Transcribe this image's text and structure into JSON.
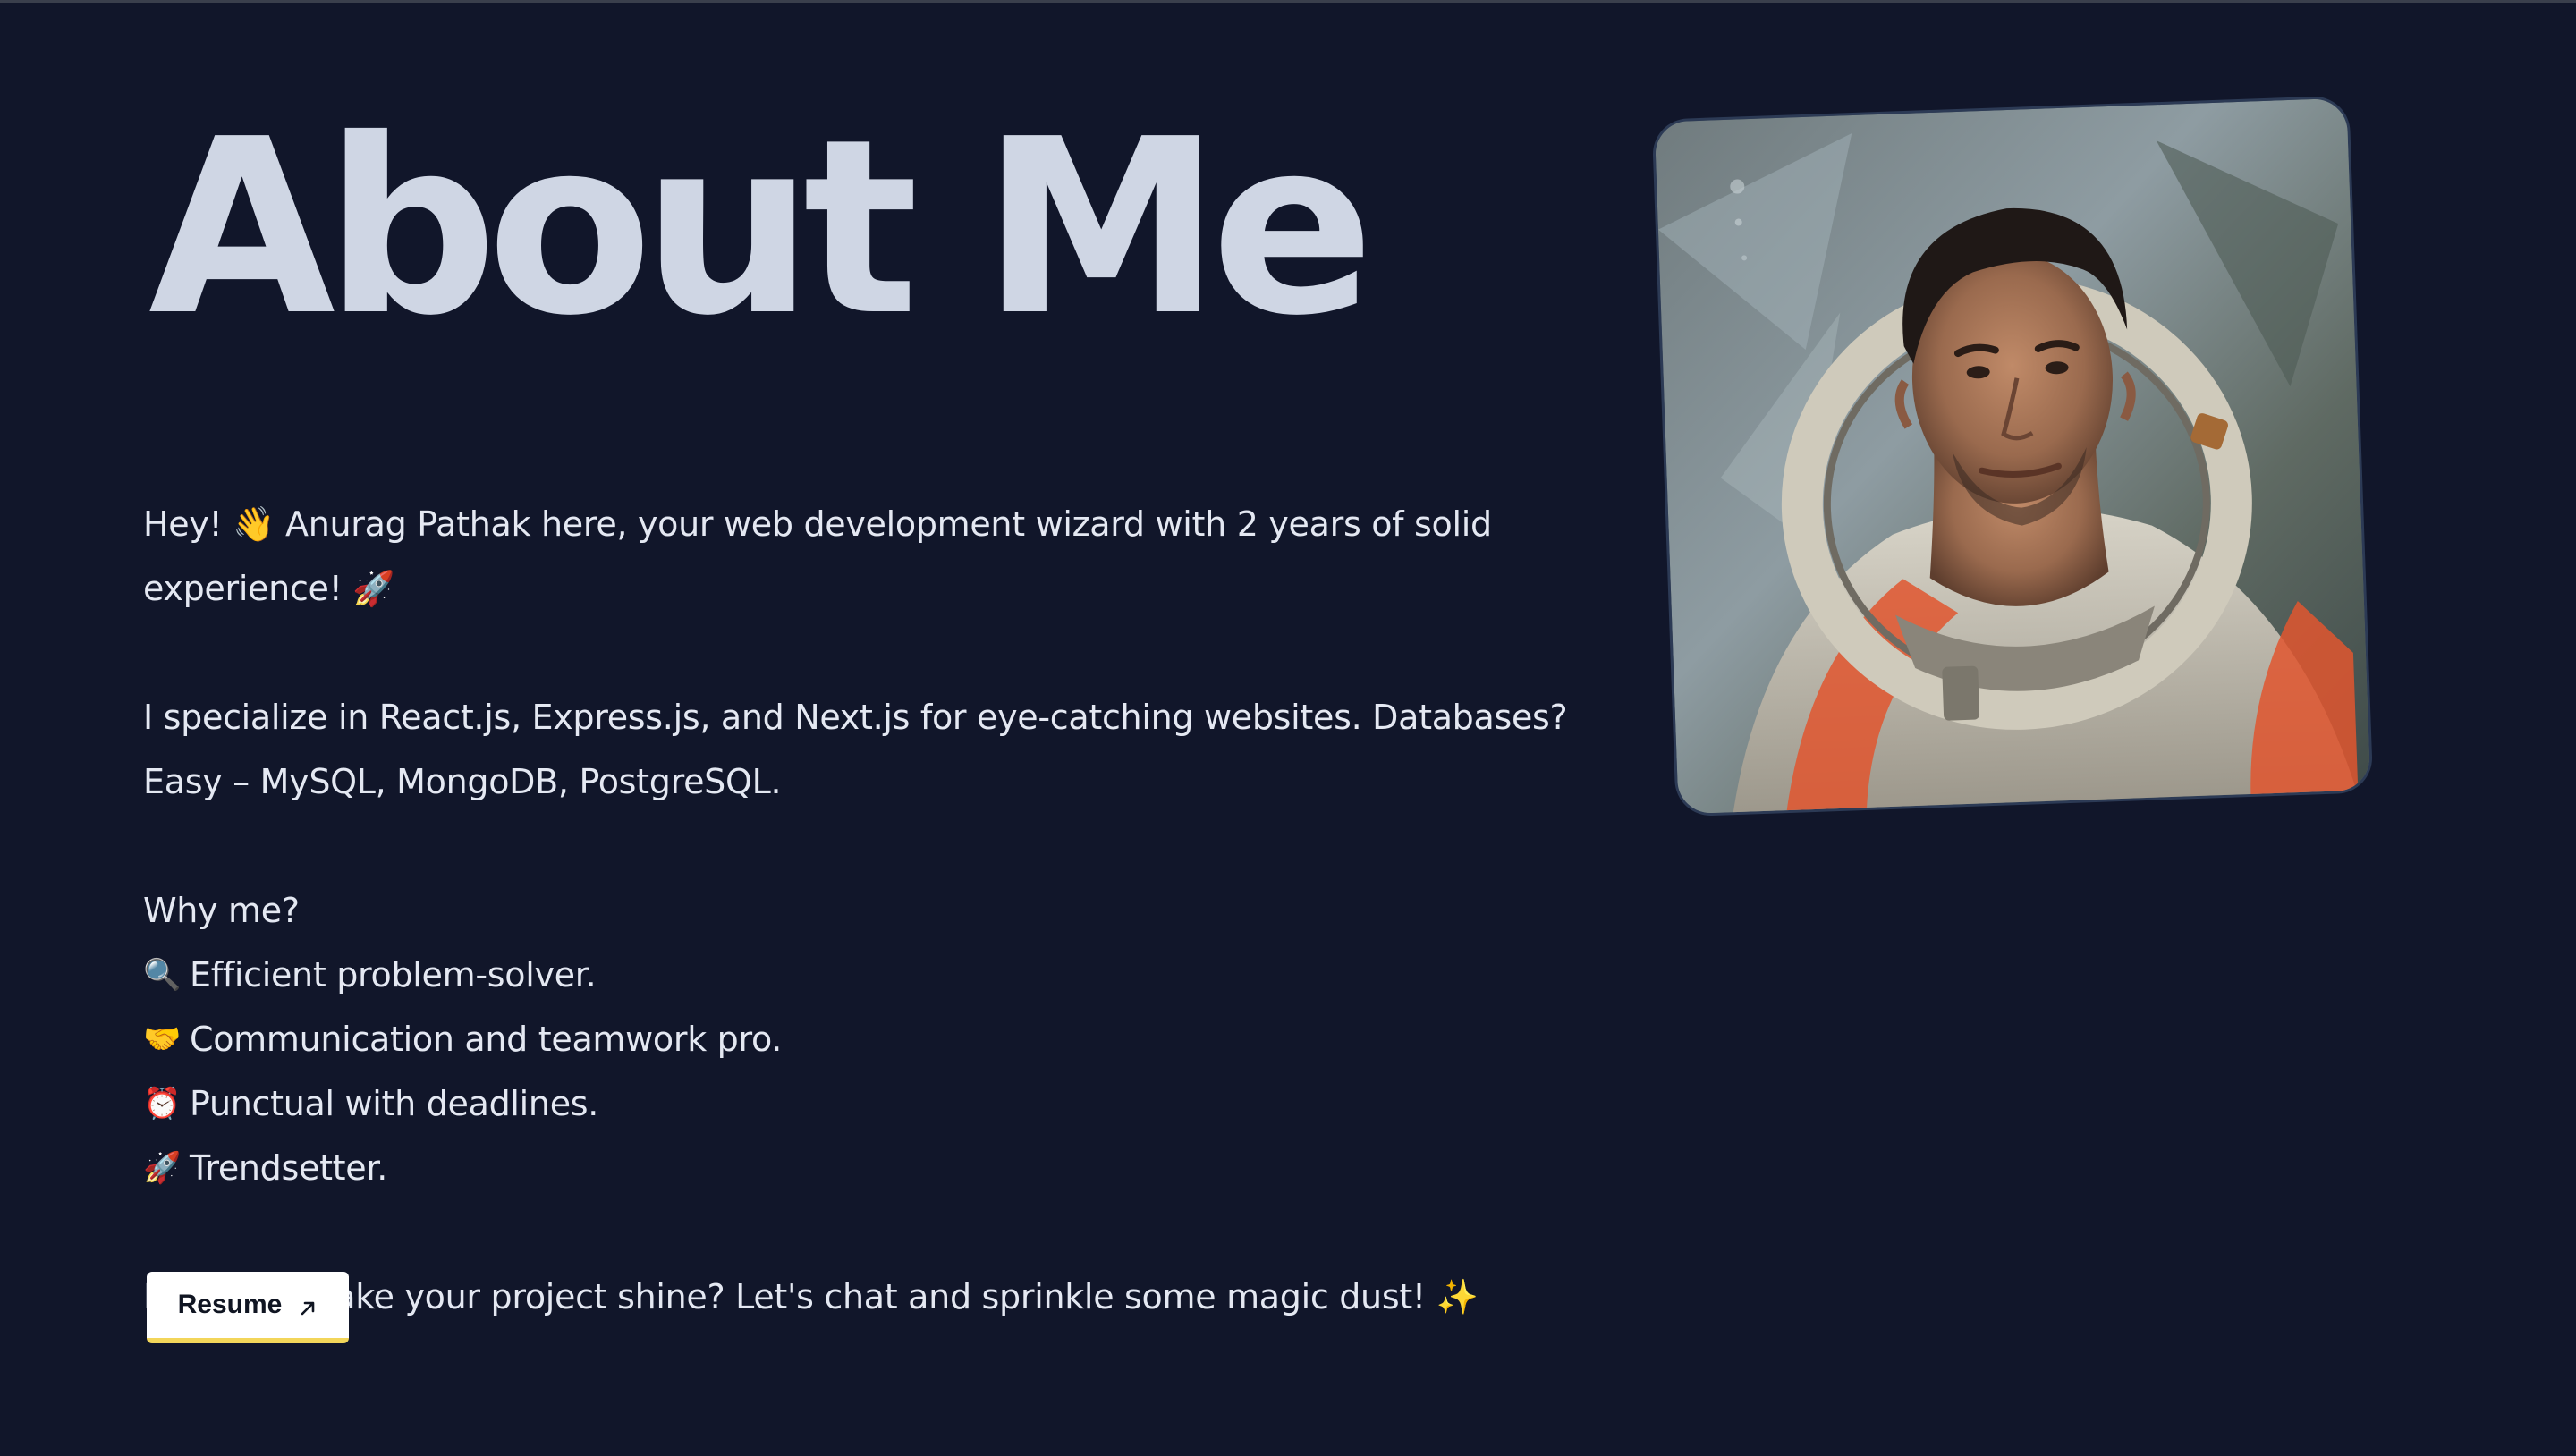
{
  "page": {
    "title": "About Me",
    "intro": "Hey! 👋 Anurag Pathak here, your web development wizard with 2 years of solid experience! 🚀",
    "skills": "I specialize in React.js, Express.js, and Next.js for eye-catching websites. Databases? Easy – MySQL, MongoDB, PostgreSQL.",
    "why_heading": "Why me?",
    "features": [
      {
        "emoji": "🔍",
        "text": "Efficient problem-solver."
      },
      {
        "emoji": "🤝",
        "text": "Communication and teamwork pro."
      },
      {
        "emoji": "⏰",
        "text": "Punctual with deadlines."
      },
      {
        "emoji": "🚀",
        "text": "Trendsetter."
      }
    ],
    "closing": "Ready to make your project shine? Let's chat and sprinkle some magic dust! ✨",
    "resume_label": "Resume"
  },
  "icons": {
    "resume_arrow": "arrow-up-right-icon"
  },
  "colors": {
    "background": "#11162a",
    "title": "#cfd6e4",
    "body_text": "#e4e8f2",
    "button_bg": "#ffffff",
    "button_accent": "#f3d65a",
    "portrait_border": "#2c3a55"
  }
}
